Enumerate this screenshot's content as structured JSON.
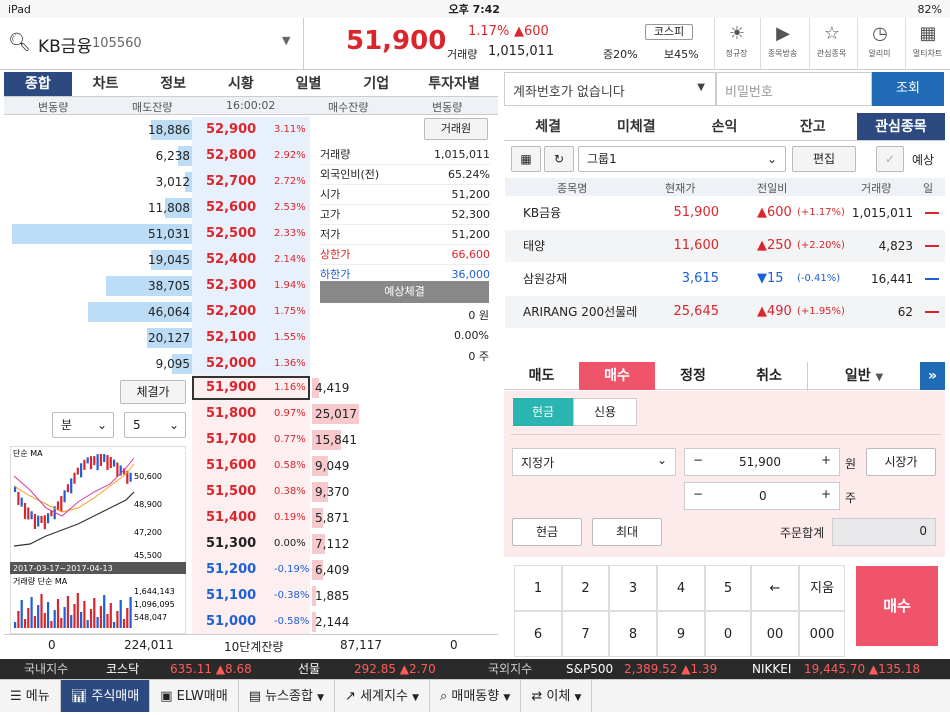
{
  "status": {
    "device": "iPad",
    "time": "오후 7:42",
    "battery": "82%"
  },
  "stock": {
    "name": "KB금융",
    "code": "105560",
    "price": "51,900",
    "change_pct": "1.17%",
    "change_amt": "▲600",
    "volume_label": "거래량",
    "volume": "1,015,011",
    "market": "코스피",
    "margin_label": "증20%",
    "ratio": "보45%"
  },
  "header_buttons": [
    "정규장",
    "종목방송",
    "관심종목",
    "알리미",
    "멀티차트"
  ],
  "left_tabs": [
    "종합",
    "차트",
    "정보",
    "시황",
    "일별",
    "기업",
    "투자자별"
  ],
  "ob_header": {
    "sell_change": "변동량",
    "sell_rem": "매도잔량",
    "time": "16:00:02",
    "buy_rem": "매수잔량",
    "buy_change": "변동량"
  },
  "sell_rows": [
    {
      "qty": "18,886",
      "price": "52,900",
      "pct": "3.11%",
      "bar": 0.23
    },
    {
      "qty": "6,238",
      "price": "52,800",
      "pct": "2.92%",
      "bar": 0.08
    },
    {
      "qty": "3,012",
      "price": "52,700",
      "pct": "2.72%",
      "bar": 0.04
    },
    {
      "qty": "11,808",
      "price": "52,600",
      "pct": "2.53%",
      "bar": 0.15
    },
    {
      "qty": "51,031",
      "price": "52,500",
      "pct": "2.33%",
      "bar": 1.0
    },
    {
      "qty": "19,045",
      "price": "52,400",
      "pct": "2.14%",
      "bar": 0.23
    },
    {
      "qty": "38,705",
      "price": "52,300",
      "pct": "1.94%",
      "bar": 0.48
    },
    {
      "qty": "46,064",
      "price": "52,200",
      "pct": "1.75%",
      "bar": 0.58
    },
    {
      "qty": "20,127",
      "price": "52,100",
      "pct": "1.55%",
      "bar": 0.25
    },
    {
      "qty": "9,095",
      "price": "52,000",
      "pct": "1.36%",
      "bar": 0.11
    }
  ],
  "buy_rows": [
    {
      "price": "51,900",
      "pct": "1.16%",
      "qty": "4,419",
      "bar": 0.04
    },
    {
      "price": "51,800",
      "pct": "0.97%",
      "qty": "25,017",
      "bar": 0.26
    },
    {
      "price": "51,700",
      "pct": "0.77%",
      "qty": "15,841",
      "bar": 0.16
    },
    {
      "price": "51,600",
      "pct": "0.58%",
      "qty": "9,049",
      "bar": 0.09
    },
    {
      "price": "51,500",
      "pct": "0.38%",
      "qty": "9,370",
      "bar": 0.09
    },
    {
      "price": "51,400",
      "pct": "0.19%",
      "qty": "5,871",
      "bar": 0.06
    },
    {
      "price": "51,300",
      "pct": "0.00%",
      "qty": "7,112",
      "bar": 0.07
    },
    {
      "price": "51,200",
      "pct": "-0.19%",
      "qty": "6,409",
      "bar": 0.06
    },
    {
      "price": "51,100",
      "pct": "-0.38%",
      "qty": "1,885",
      "bar": 0.02
    },
    {
      "price": "51,000",
      "pct": "-0.58%",
      "qty": "2,144",
      "bar": 0.02
    }
  ],
  "info_btn": "거래원",
  "info": [
    {
      "k": "거래량",
      "v": "1,015,011"
    },
    {
      "k": "외국인비(전)",
      "v": "65.24%"
    },
    {
      "k": "시가",
      "v": "51,200"
    },
    {
      "k": "고가",
      "v": "52,300"
    },
    {
      "k": "저가",
      "v": "51,200"
    },
    {
      "k": "상한가",
      "v": "66,600"
    },
    {
      "k": "하한가",
      "v": "36,000"
    }
  ],
  "expect_label": "예상체결",
  "expect": [
    "0 원",
    "0.00%",
    "0 주"
  ],
  "chegyeol_btn": "체결가",
  "chart_period": "분",
  "chart_interval": "5",
  "chart_labels": {
    "ma_title": "단순 MA",
    "ma_nums": [
      "5",
      "10",
      "20",
      "60",
      "120"
    ],
    "ticks": [
      "50,600",
      "48,900",
      "47,200",
      "45,500"
    ],
    "top_price": "52,300",
    "date_range": "2017-03-17~2017-04-13",
    "vol_title": "거래량 단순 MA",
    "vol_nums": [
      "5",
      "10",
      "20"
    ],
    "vol_ticks": [
      "1,644,143",
      "1,096,095",
      "548,047"
    ]
  },
  "ob_footer": {
    "left0": "0",
    "sell_total": "224,011",
    "label": "10단계잔량",
    "buy_total": "87,117",
    "right0": "0"
  },
  "account": {
    "placeholder": "계좌번호가 없습니다",
    "pw_placeholder": "비밀번호",
    "query": "조회"
  },
  "right_tabs": [
    "체결",
    "미체결",
    "손익",
    "잔고",
    "관심종목"
  ],
  "group": {
    "name": "그룹1",
    "edit": "편집",
    "expect": "예상"
  },
  "wl_header": [
    "종목명",
    "현재가",
    "전일비",
    "거래량",
    "일"
  ],
  "watchlist": [
    {
      "name": "KB금융",
      "price": "51,900",
      "diff": "▲600",
      "pct": "(+1.17%)",
      "vol": "1,015,011",
      "up": true
    },
    {
      "name": "태양",
      "price": "11,600",
      "diff": "▲250",
      "pct": "(+2.20%)",
      "vol": "4,823",
      "up": true
    },
    {
      "name": "삼원강재",
      "price": "3,615",
      "diff": "▼15",
      "pct": "(-0.41%)",
      "vol": "16,441",
      "up": false
    },
    {
      "name": "ARIRANG 200선물레",
      "price": "25,645",
      "diff": "▲490",
      "pct": "(+1.95%)",
      "vol": "62",
      "up": true
    }
  ],
  "order_tabs": [
    "매도",
    "매수",
    "정정",
    "취소"
  ],
  "order_type": "일반",
  "pay": [
    "현금",
    "신용"
  ],
  "order": {
    "kind": "지정가",
    "price": "51,900",
    "unit_won": "원",
    "qty": "0",
    "unit_ju": "주",
    "market_btn": "시장가",
    "cash_btn": "현금",
    "max_btn": "최대",
    "total_label": "주문합계",
    "total": "0",
    "buy_btn": "매수"
  },
  "keypad": [
    "1",
    "2",
    "3",
    "4",
    "5",
    "←",
    "지움",
    "6",
    "7",
    "8",
    "9",
    "0",
    "00",
    "000"
  ],
  "ticker": [
    {
      "k": "국내지수",
      "v": ""
    },
    {
      "k": "코스닥",
      "v": "635.11 ▲8.68"
    },
    {
      "k": "선물",
      "v": "292.85 ▲2.70"
    },
    {
      "k": "국외지수",
      "v": ""
    },
    {
      "k": "S&P500",
      "v": "2,389.52 ▲1.39"
    },
    {
      "k": "NIKKEI",
      "v": "19,445.70 ▲135.18"
    }
  ],
  "nav": [
    "메뉴",
    "주식매매",
    "ELW매매",
    "뉴스종합",
    "세계지수",
    "매매동향",
    "이체"
  ]
}
